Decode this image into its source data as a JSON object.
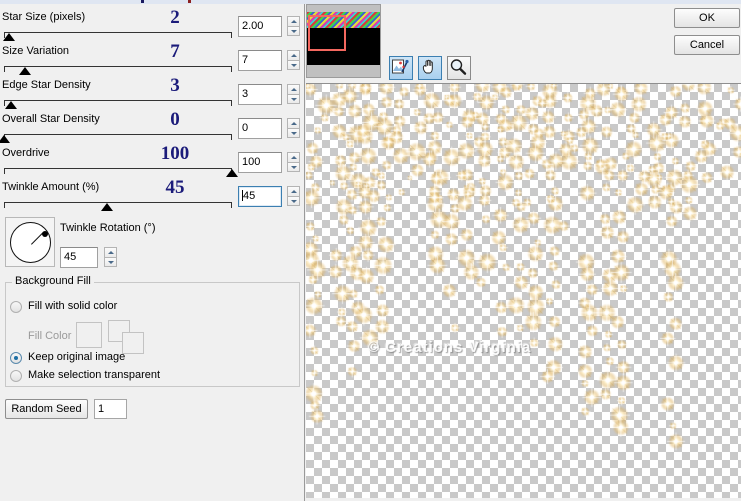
{
  "dialog": {
    "ok_label": "OK",
    "cancel_label": "Cancel"
  },
  "sliders": [
    {
      "label": "Star Size (pixels)",
      "display_value": "2",
      "field_value": "2.00",
      "percent": 2,
      "focused": false
    },
    {
      "label": "Size Variation",
      "display_value": "7",
      "field_value": "7",
      "percent": 9,
      "focused": false
    },
    {
      "label": "Edge Star Density",
      "display_value": "3",
      "field_value": "3",
      "percent": 3,
      "focused": false
    },
    {
      "label": "Overall Star Density",
      "display_value": "0",
      "field_value": "0",
      "percent": 0,
      "focused": false
    },
    {
      "label": "Overdrive",
      "display_value": "100",
      "field_value": "100",
      "percent": 100,
      "focused": false
    },
    {
      "label": "Twinkle Amount (%)",
      "display_value": "45",
      "field_value": "45",
      "percent": 45,
      "focused": true
    }
  ],
  "rotation": {
    "label": "Twinkle Rotation (°)",
    "value": "45",
    "dial_icon": "rotation-dial-icon"
  },
  "background_fill": {
    "title": "Background Fill",
    "options": [
      {
        "label": "Fill with solid color",
        "selected": false,
        "disabled": false
      },
      {
        "label": "Keep original image",
        "selected": true,
        "disabled": false
      },
      {
        "label": "Make selection transparent",
        "selected": false,
        "disabled": false
      }
    ],
    "fill_color_label": "Fill Color",
    "fill_color_disabled": true
  },
  "random_seed": {
    "button_label": "Random Seed",
    "value": "1"
  },
  "navigator": {
    "name": "thumbnail-navigator",
    "selection_color": "#f4685f"
  },
  "tools": [
    {
      "name": "image-preview-tool",
      "glyph": "image",
      "selected": true
    },
    {
      "name": "pan-hand-tool",
      "glyph": "hand",
      "selected": true
    },
    {
      "name": "zoom-magnifier-tool",
      "glyph": "zoom",
      "selected": false
    }
  ],
  "preview": {
    "watermark": "© Creations Virginia",
    "background": "transparency-checkerboard"
  },
  "colors": {
    "value_blue": "#1b1b7a",
    "panel_bg": "#f0f0f0",
    "focus_border": "#3c7fb1"
  }
}
